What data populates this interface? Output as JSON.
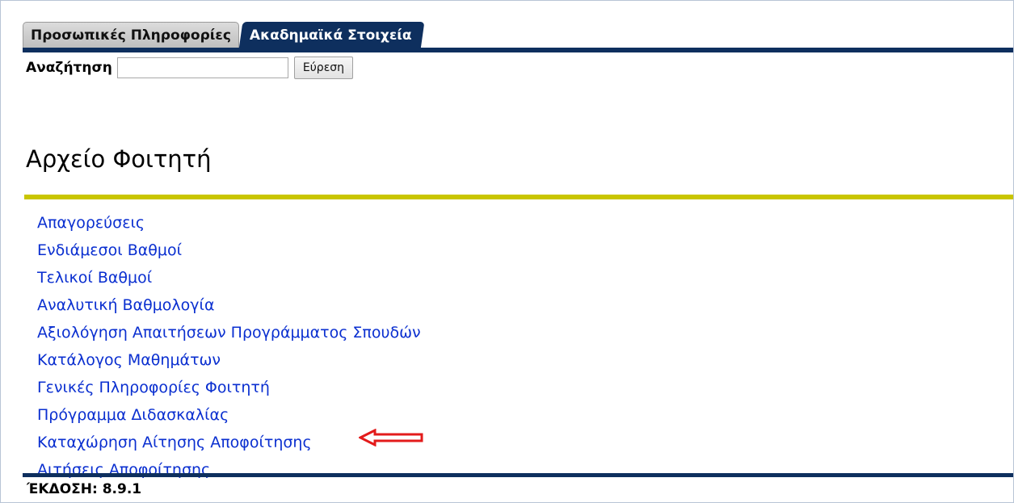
{
  "tabs": [
    {
      "label": "Προσωπικές Πληροφορίες",
      "active": false
    },
    {
      "label": "Ακαδημαϊκά Στοιχεία",
      "active": true
    }
  ],
  "search": {
    "label": "Αναζήτηση",
    "value": "",
    "placeholder": "",
    "button_label": "Εύρεση"
  },
  "page": {
    "title": "Αρχείο Φοιτητή"
  },
  "menu": {
    "items": [
      {
        "label": "Απαγορεύσεις"
      },
      {
        "label": "Ενδιάμεσοι Βαθμοί"
      },
      {
        "label": "Τελικοί Βαθμοί"
      },
      {
        "label": "Αναλυτική Βαθμολογία"
      },
      {
        "label": "Αξιολόγηση Απαιτήσεων Προγράμματος Σπουδών"
      },
      {
        "label": "Κατάλογος Μαθημάτων"
      },
      {
        "label": "Γενικές Πληροφορίες Φοιτητή"
      },
      {
        "label": "Πρόγραμμα Διδασκαλίας"
      },
      {
        "label": "Καταχώρηση Αίτησης Αποφοίτησης",
        "highlighted": true
      },
      {
        "label": "Αιτήσεις Αποφοίτησης"
      }
    ]
  },
  "annotation": {
    "icon": "left-arrow-icon",
    "color": "#e31b1b"
  },
  "footer": {
    "version": "ΈΚΔΟΣΗ: 8.9.1"
  },
  "colors": {
    "navy": "#0e2f5e",
    "accent_rule": "#c9c500",
    "link": "#0a2fd0"
  }
}
